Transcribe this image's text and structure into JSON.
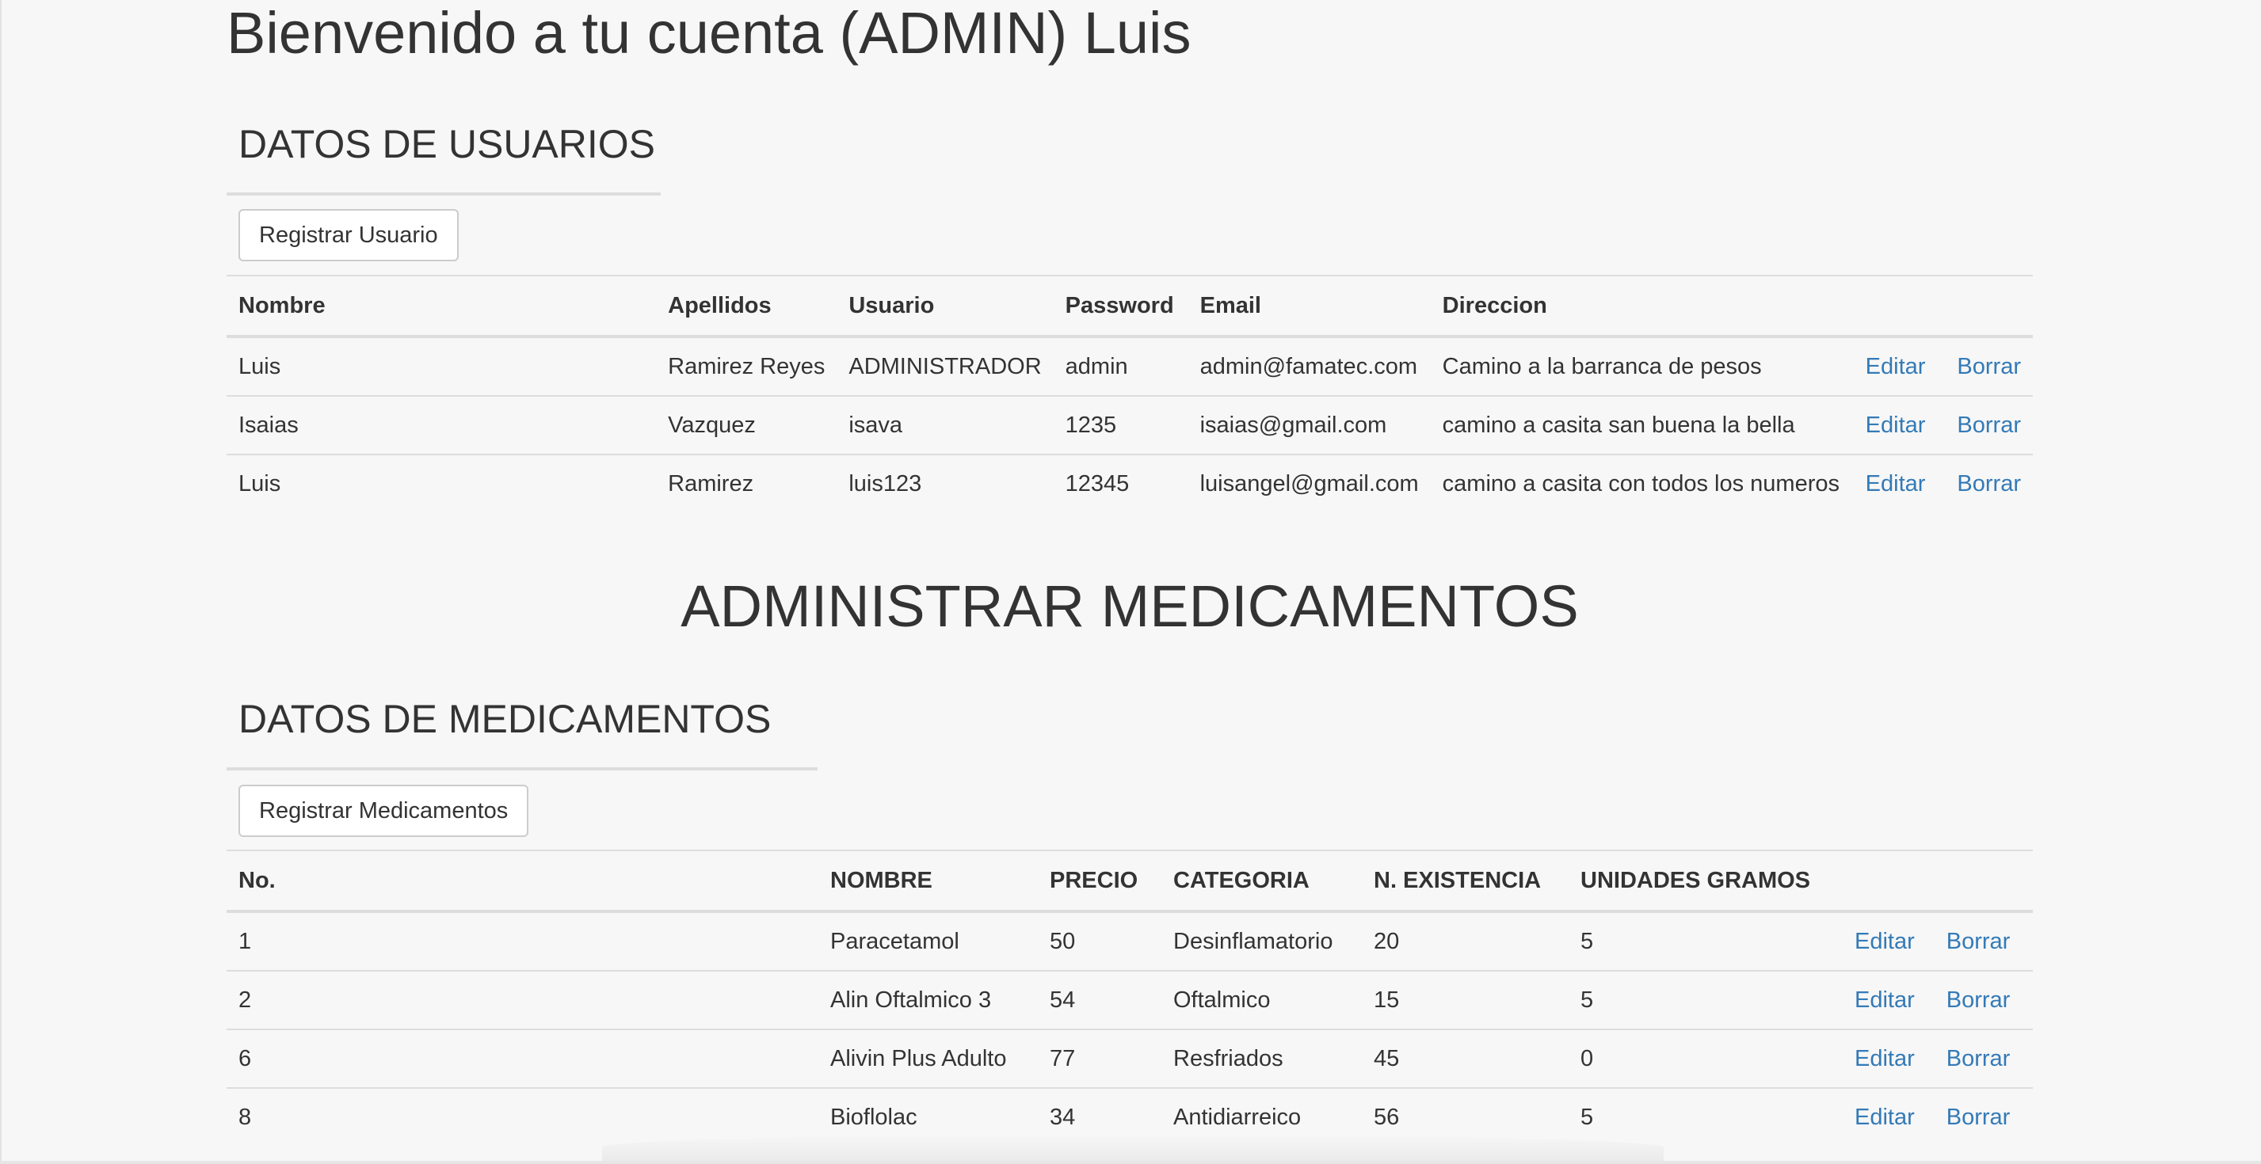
{
  "welcome_title": "Bienvenido a tu cuenta (ADMIN) Luis",
  "users_section": {
    "heading": "DATOS DE USUARIOS",
    "register_button": "Registrar Usuario",
    "columns": [
      "Nombre",
      "Apellidos",
      "Usuario",
      "Password",
      "Email",
      "Direccion"
    ],
    "rows": [
      {
        "nombre": "Luis",
        "apellidos": "Ramirez Reyes",
        "usuario": "ADMINISTRADOR",
        "password": "admin",
        "email": "admin@famatec.com",
        "direccion": "Camino a la barranca de pesos",
        "edit": "Editar",
        "delete": "Borrar"
      },
      {
        "nombre": "Isaias",
        "apellidos": "Vazquez",
        "usuario": "isava",
        "password": "1235",
        "email": "isaias@gmail.com",
        "direccion": "camino a casita san buena la bella",
        "edit": "Editar",
        "delete": "Borrar"
      },
      {
        "nombre": "Luis",
        "apellidos": "Ramirez",
        "usuario": "luis123",
        "password": "12345",
        "email": "luisangel@gmail.com",
        "direccion": "camino a casita con todos los numeros",
        "edit": "Editar",
        "delete": "Borrar"
      }
    ]
  },
  "meds_title": "ADMINISTRAR MEDICAMENTOS",
  "meds_section": {
    "heading": "DATOS DE MEDICAMENTOS",
    "register_button": "Registrar Medicamentos",
    "columns": [
      "No.",
      "NOMBRE",
      "PRECIO",
      "CATEGORIA",
      "N. EXISTENCIA",
      "UNIDADES GRAMOS"
    ],
    "rows": [
      {
        "no": "1",
        "nombre": "Paracetamol",
        "precio": "50",
        "categoria": "Desinflamatorio",
        "existencia": "20",
        "unidades": "5",
        "edit": "Editar",
        "delete": "Borrar"
      },
      {
        "no": "2",
        "nombre": "Alin Oftalmico 3",
        "precio": "54",
        "categoria": "Oftalmico",
        "existencia": "15",
        "unidades": "5",
        "edit": "Editar",
        "delete": "Borrar"
      },
      {
        "no": "6",
        "nombre": "Alivin Plus Adulto",
        "precio": "77",
        "categoria": "Resfriados",
        "existencia": "45",
        "unidades": "0",
        "edit": "Editar",
        "delete": "Borrar"
      },
      {
        "no": "8",
        "nombre": "Bioflolac",
        "precio": "34",
        "categoria": "Antidiarreico",
        "existencia": "56",
        "unidades": "5",
        "edit": "Editar",
        "delete": "Borrar"
      }
    ]
  },
  "colors": {
    "background": "#f7f7f7",
    "text": "#333333",
    "link": "#337ab7",
    "border": "#dddddd"
  }
}
